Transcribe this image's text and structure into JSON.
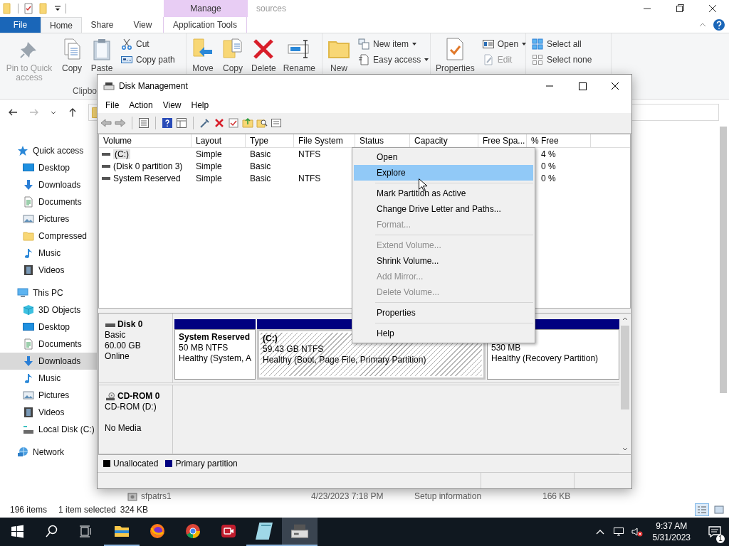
{
  "explorer": {
    "title": "sources",
    "contextual_group": "Manage",
    "tabs": [
      {
        "label": "File",
        "kind": "file",
        "selected": false
      },
      {
        "label": "Home",
        "kind": "tab",
        "selected": true
      },
      {
        "label": "Share",
        "kind": "tab",
        "selected": false
      },
      {
        "label": "View",
        "kind": "tab",
        "selected": false
      },
      {
        "label": "Application Tools",
        "kind": "contextual",
        "selected": false
      }
    ],
    "ribbon": [
      {
        "label": "Clipbo",
        "items": [
          {
            "label": "Pin to Quick access",
            "kind": "large",
            "disabled": true
          },
          {
            "label": "Copy",
            "kind": "large",
            "disabled": false
          },
          {
            "label": "Paste",
            "kind": "large",
            "disabled": false
          },
          {
            "label": "Cut",
            "kind": "small",
            "disabled": false
          },
          {
            "label": "Copy path",
            "kind": "small",
            "disabled": false
          }
        ]
      },
      {
        "items": [
          {
            "label": "Move",
            "kind": "large",
            "disabled": false
          },
          {
            "label": "Copy",
            "kind": "large",
            "disabled": false
          },
          {
            "label": "Delete",
            "kind": "large",
            "disabled": false
          },
          {
            "label": "Rename",
            "kind": "large",
            "disabled": false
          }
        ]
      },
      {
        "items": [
          {
            "label": "New",
            "kind": "large",
            "disabled": false
          },
          {
            "label": "New item",
            "kind": "small",
            "disabled": false,
            "dropdown": true
          },
          {
            "label": "Easy access",
            "kind": "small",
            "disabled": false,
            "dropdown": true
          }
        ]
      },
      {
        "items": [
          {
            "label": "Properties",
            "kind": "large",
            "disabled": false
          },
          {
            "label": "Open",
            "kind": "small",
            "disabled": false,
            "dropdown": true
          },
          {
            "label": "Edit",
            "kind": "small",
            "disabled": true
          }
        ]
      },
      {
        "items": [
          {
            "label": "Select all",
            "kind": "small",
            "disabled": false
          },
          {
            "label": "Select none",
            "kind": "small",
            "disabled": false
          }
        ]
      }
    ],
    "nav_tree": [
      {
        "label": "Quick access",
        "selected": false,
        "children": [
          {
            "label": "Desktop",
            "selected": false
          },
          {
            "label": "Downloads",
            "selected": false
          },
          {
            "label": "Documents",
            "selected": false
          },
          {
            "label": "Pictures",
            "selected": false
          },
          {
            "label": "Compressed",
            "selected": false
          },
          {
            "label": "Music",
            "selected": false
          },
          {
            "label": "Videos",
            "selected": false
          }
        ]
      },
      {
        "label": "This PC",
        "selected": false,
        "children": [
          {
            "label": "3D Objects",
            "selected": false
          },
          {
            "label": "Desktop",
            "selected": false
          },
          {
            "label": "Documents",
            "selected": false
          },
          {
            "label": "Downloads",
            "selected": true
          },
          {
            "label": "Music",
            "selected": false
          },
          {
            "label": "Pictures",
            "selected": false
          },
          {
            "label": "Videos",
            "selected": false
          },
          {
            "label": "Local Disk (C:)",
            "selected": false
          }
        ]
      },
      {
        "label": "Network",
        "selected": false
      }
    ],
    "file_row": {
      "name": "sfpatrs1",
      "date": "4/23/2023 7:18 PM",
      "type": "Setup information",
      "size": "166 KB"
    },
    "status_bar": {
      "count": "196 items",
      "selection": "1 item selected",
      "size": "324 KB"
    },
    "view_buttons": [
      {
        "selected": true
      },
      {
        "selected": false
      }
    ]
  },
  "disk_management": {
    "title": "Disk Management",
    "menu": [
      "File",
      "Action",
      "View",
      "Help"
    ],
    "table": {
      "columns": [
        "Volume",
        "Layout",
        "Type",
        "File System",
        "Status",
        "Capacity",
        "Free Spa...",
        "% Free"
      ],
      "rows": [
        {
          "volume": "(C:)",
          "layout": "Simple",
          "type": "Basic",
          "file_system": "NTFS",
          "pct_free": "4 %",
          "selected": true
        },
        {
          "volume": "(Disk 0 partition 3)",
          "layout": "Simple",
          "type": "Basic",
          "pct_free": "0 %",
          "selected": false
        },
        {
          "volume": "System Reserved",
          "layout": "Simple",
          "type": "Basic",
          "file_system": "NTFS",
          "pct_free": "0 %",
          "selected": false
        }
      ]
    },
    "disks": [
      {
        "name": "Disk 0",
        "kind": "hdd",
        "type": "Basic",
        "size": "60.00 GB",
        "status": "Online",
        "partitions": [
          {
            "kind": "primary",
            "title": "System Reserved",
            "size": "50 MB NTFS",
            "status": "Healthy (System, A",
            "selected": false
          },
          {
            "kind": "primary",
            "title": "(C:)",
            "size": "59.43 GB NTFS",
            "status": "Healthy (Boot, Page File, Primary Partition)",
            "selected": true
          },
          {
            "kind": "primary",
            "size": "530 MB",
            "status": "Healthy (Recovery Partition)",
            "selected": false
          }
        ]
      },
      {
        "name": "CD-ROM 0",
        "kind": "cdrom",
        "type": "CD-ROM (D:)",
        "status": "No Media"
      }
    ],
    "legend": [
      {
        "label": "Unallocated",
        "color": "#000000"
      },
      {
        "label": "Primary partition",
        "color": "#000080"
      }
    ],
    "context_menu": [
      {
        "kind": "item",
        "label": "Open",
        "disabled": false,
        "selected": false
      },
      {
        "kind": "item",
        "label": "Explore",
        "disabled": false,
        "selected": true
      },
      {
        "kind": "separator"
      },
      {
        "kind": "item",
        "label": "Mark Partition as Active",
        "disabled": false,
        "selected": false
      },
      {
        "kind": "item",
        "label": "Change Drive Letter and Paths...",
        "disabled": false,
        "selected": false
      },
      {
        "kind": "item",
        "label": "Format...",
        "disabled": true,
        "selected": false
      },
      {
        "kind": "separator"
      },
      {
        "kind": "item",
        "label": "Extend Volume...",
        "disabled": true,
        "selected": false
      },
      {
        "kind": "item",
        "label": "Shrink Volume...",
        "disabled": false,
        "selected": false
      },
      {
        "kind": "item",
        "label": "Add Mirror...",
        "disabled": true,
        "selected": false
      },
      {
        "kind": "item",
        "label": "Delete Volume...",
        "disabled": true,
        "selected": false
      },
      {
        "kind": "separator"
      },
      {
        "kind": "item",
        "label": "Properties",
        "disabled": false,
        "selected": false
      },
      {
        "kind": "separator"
      },
      {
        "kind": "item",
        "label": "Help",
        "disabled": false,
        "selected": false
      }
    ]
  },
  "taskbar": {
    "apps": [
      {
        "open": true,
        "active": false
      },
      {
        "open": false,
        "active": false
      },
      {
        "open": false,
        "active": false
      },
      {
        "open": false,
        "active": false
      },
      {
        "open": true,
        "active": false
      },
      {
        "open": true,
        "active": true
      }
    ],
    "clock": {
      "time": "9:37 AM",
      "date": "5/31/2023"
    },
    "notifications": "1"
  }
}
